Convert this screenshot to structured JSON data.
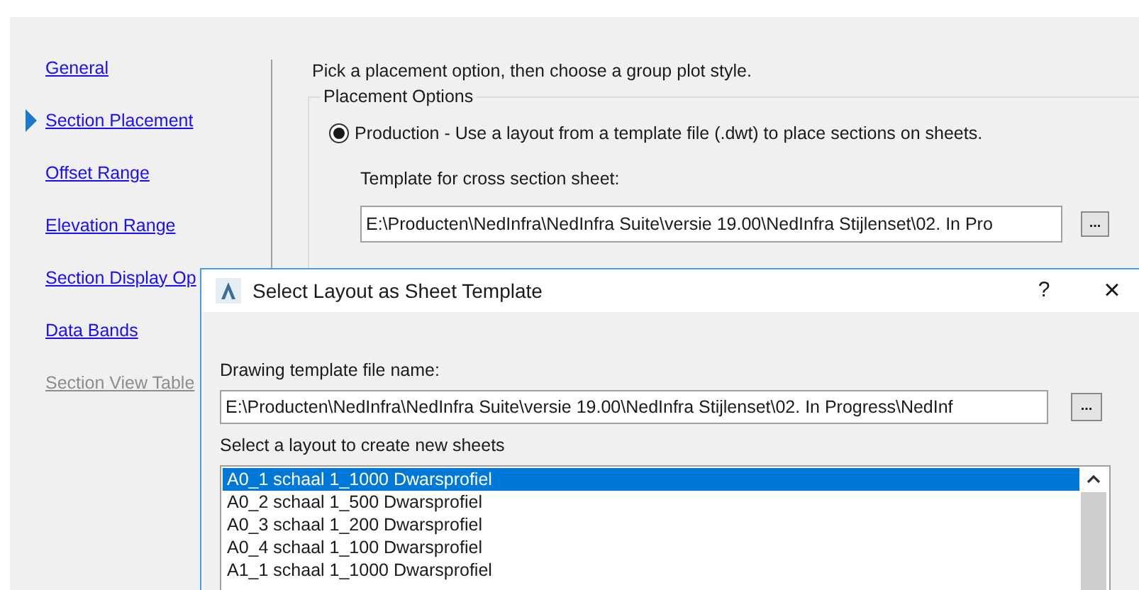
{
  "sidebar": {
    "items": [
      {
        "label": "General",
        "selected": false,
        "disabled": false
      },
      {
        "label": "Section Placement",
        "selected": true,
        "disabled": false
      },
      {
        "label": "Offset Range",
        "selected": false,
        "disabled": false
      },
      {
        "label": "Elevation Range",
        "selected": false,
        "disabled": false
      },
      {
        "label": "Section Display Op",
        "selected": false,
        "disabled": false
      },
      {
        "label": "Data Bands",
        "selected": false,
        "disabled": false
      },
      {
        "label": "Section View Table",
        "selected": false,
        "disabled": true
      }
    ]
  },
  "instruction": "Pick a placement option, then choose a group plot style.",
  "placement_options": {
    "title": "Placement Options",
    "radio": {
      "label": "Production - Use a layout from a template file (.dwt) to place sections on sheets.",
      "selected": true
    },
    "template_label": "Template for cross section sheet:",
    "template_value": "E:\\Producten\\NedInfra\\NedInfra Suite\\versie 19.00\\NedInfra Stijlenset\\02. In Pro",
    "browse_button": "..."
  },
  "dialog": {
    "title": "Select Layout as Sheet Template",
    "help_button": "?",
    "close_button": "×",
    "file_label": "Drawing template file name:",
    "file_value": "E:\\Producten\\NedInfra\\NedInfra Suite\\versie 19.00\\NedInfra Stijlenset\\02. In Progress\\NedInf",
    "browse_button": "...",
    "list_label": "Select a layout to create new sheets",
    "layouts": [
      {
        "label": "A0_1 schaal 1_1000 Dwarsprofiel",
        "selected": true
      },
      {
        "label": "A0_2 schaal 1_500 Dwarsprofiel",
        "selected": false
      },
      {
        "label": "A0_3 schaal 1_200 Dwarsprofiel",
        "selected": false
      },
      {
        "label": "A0_4 schaal 1_100 Dwarsprofiel",
        "selected": false
      },
      {
        "label": "A1_1 schaal 1_1000 Dwarsprofiel",
        "selected": false
      }
    ]
  }
}
